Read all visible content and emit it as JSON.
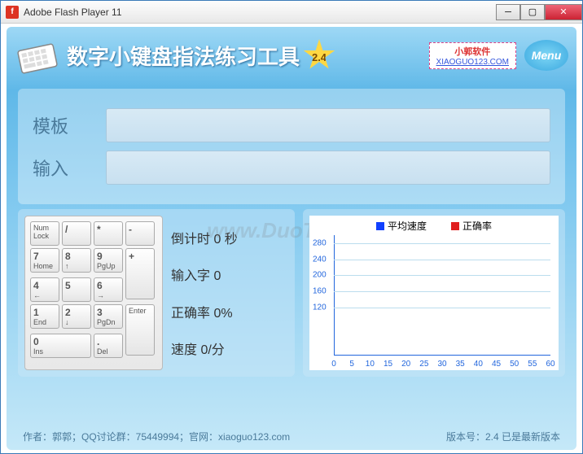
{
  "window": {
    "title": "Adobe Flash Player 11"
  },
  "header": {
    "app_title": "数字小键盘指法练习工具",
    "version_star": "2.4",
    "brand_name": "小郭软件",
    "brand_url": "XIAOGUO123.COM",
    "menu_label": "Menu"
  },
  "fields": {
    "template_label": "模板",
    "input_label": "输入"
  },
  "keypad": {
    "numlock": "Num Lock",
    "slash": "/",
    "star": "*",
    "minus": "-",
    "k7": "7",
    "k7s": "Home",
    "k8": "8",
    "k8s": "↑",
    "k9": "9",
    "k9s": "PgUp",
    "plus": "+",
    "k4": "4",
    "k4s": "←",
    "k5": "5",
    "k6": "6",
    "k6s": "→",
    "k1": "1",
    "k1s": "End",
    "k2": "2",
    "k2s": "↓",
    "k3": "3",
    "k3s": "PgDn",
    "enter": "Enter",
    "k0": "0",
    "k0s": "Ins",
    "dot": ".",
    "dots": "Del"
  },
  "stats": {
    "countdown": "倒计时 0 秒",
    "typed": "输入字 0",
    "accuracy": "正确率 0%",
    "speed": "速度  0/分"
  },
  "chart_data": {
    "type": "line",
    "series": [
      {
        "name": "平均速度",
        "color": "#1040ff",
        "values": []
      },
      {
        "name": "正确率",
        "color": "#e02020",
        "values": []
      }
    ],
    "xlabel": "",
    "ylabel": "",
    "xlim": [
      0,
      60
    ],
    "ylim": [
      0,
      300
    ],
    "xticks": [
      0,
      5,
      10,
      15,
      20,
      25,
      30,
      35,
      40,
      45,
      50,
      55,
      60
    ],
    "yticks": [
      120,
      160,
      200,
      240,
      280
    ]
  },
  "footer": {
    "left": "作者：郭郭；QQ讨论群：75449994；官网：xiaoguo123.com",
    "right": "版本号：2.4  已是最新版本"
  },
  "watermark": "www.DuoTe.com"
}
